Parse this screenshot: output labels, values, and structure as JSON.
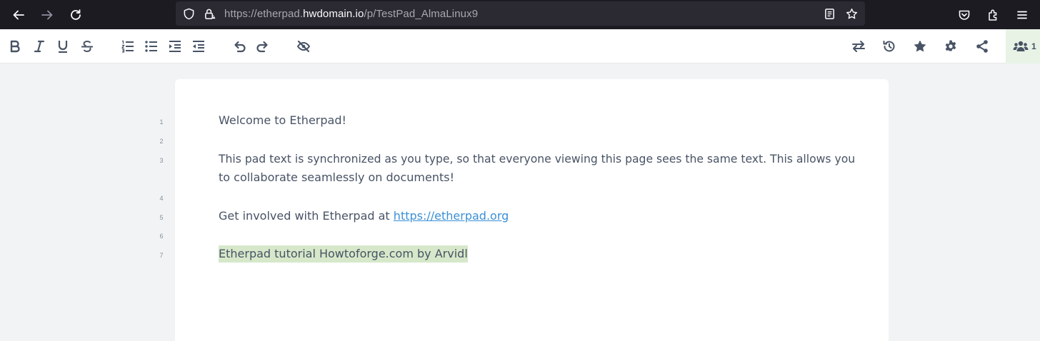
{
  "browser": {
    "url_prefix": "https://etherpad.",
    "url_domain": "hwdomain.io",
    "url_path": "/p/TestPad_AlmaLinux9"
  },
  "toolbar": {
    "users_count": "1"
  },
  "editor": {
    "line_numbers": [
      "1",
      "2",
      "3",
      "4",
      "5",
      "6",
      "7"
    ],
    "line1": "Welcome to Etherpad!",
    "line3a": "This pad text is synchronized as you type, so that everyone viewing this page sees the same text. This allows you",
    "line3b": "to collaborate seamlessly on documents!",
    "line5_text": "Get involved with Etherpad at ",
    "line5_link": "https://etherpad.org",
    "line7": "Etherpad tutorial Howtoforge.com by Arvidl",
    "highlight_color": "#d6e8c9"
  }
}
